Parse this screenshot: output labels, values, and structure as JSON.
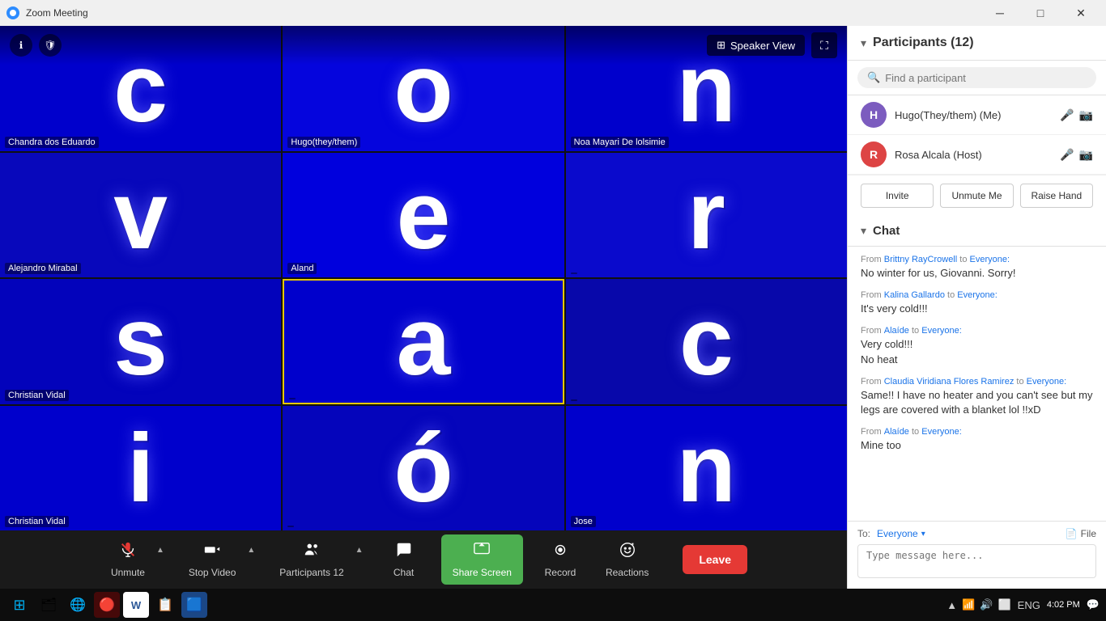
{
  "titlebar": {
    "title": "Zoom Meeting",
    "min_btn": "─",
    "max_btn": "□",
    "close_btn": "✕"
  },
  "video_area": {
    "speaker_view_label": "Speaker View",
    "cells": [
      {
        "letter": "c",
        "name": "Chandra dos Eduardo"
      },
      {
        "letter": "o",
        "name": "Hugo(they/them)"
      },
      {
        "letter": "n",
        "name": "Noa Mayari De lolsimie"
      },
      {
        "letter": "v",
        "name": "Alejandro Mirabal"
      },
      {
        "letter": "e",
        "name": "Aland"
      },
      {
        "letter": "r",
        "name": ""
      },
      {
        "letter": "s",
        "name": "Christian Vidal"
      },
      {
        "letter": "a",
        "name": ""
      },
      {
        "letter": "c",
        "name": ""
      },
      {
        "letter": "i",
        "name": "Christian Vidal"
      },
      {
        "letter": "ó",
        "name": ""
      },
      {
        "letter": "n",
        "name": "Jose"
      }
    ],
    "active_cell_index": 7
  },
  "toolbar": {
    "unmute_label": "Unmute",
    "stop_video_label": "Stop Video",
    "participants_label": "Participants",
    "participants_count": "12",
    "chat_label": "Chat",
    "share_screen_label": "Share Screen",
    "record_label": "Record",
    "reactions_label": "Reactions",
    "leave_label": "Leave"
  },
  "right_panel": {
    "section_title": "Participants (12)",
    "search_placeholder": "Find a participant",
    "participants": [
      {
        "name": "Hugo(They/them) (Me)",
        "avatar_initials": "H",
        "avatar_color": "#7c5cbf",
        "mic_muted": true,
        "video_on": false
      },
      {
        "name": "Rosa Alcala (Host)",
        "avatar_initials": "R",
        "avatar_color": "#cc3333",
        "mic_muted": false,
        "video_on": false
      }
    ],
    "invite_label": "Invite",
    "unmute_me_label": "Unmute Me",
    "raise_hand_label": "Raise Hand"
  },
  "chat": {
    "title": "Chat",
    "chevron": "▾",
    "messages": [
      {
        "from": "Brittny RayCrowell",
        "to": "Everyone",
        "text": "No winter for us, Giovanni. Sorry!"
      },
      {
        "from": "Kalina Gallardo",
        "to": "Everyone",
        "text": "It's very cold!!!"
      },
      {
        "from": "Alaíde",
        "to": "Everyone",
        "text": "Very cold!!!\nNo heat"
      },
      {
        "from": "Claudia Viridiana Flores Ramirez",
        "to": "Everyone",
        "text": "Same!! I have no heater and you can't see but my legs are covered with a blanket lol !!xD"
      },
      {
        "from": "Alaíde",
        "to": "Everyone",
        "text": "Mine too"
      }
    ],
    "to_label": "To:",
    "to_recipient": "Everyone",
    "file_label": "File",
    "input_placeholder": "Type message here..."
  },
  "taskbar": {
    "time": "4:02 PM",
    "date": "",
    "language": "ENG",
    "icons": [
      "⊞",
      "🗂",
      "🌐",
      "🔴",
      "W",
      "📋",
      "🟦"
    ],
    "sys_icons": [
      "▲",
      "📶",
      "🔊",
      "⬜"
    ]
  }
}
